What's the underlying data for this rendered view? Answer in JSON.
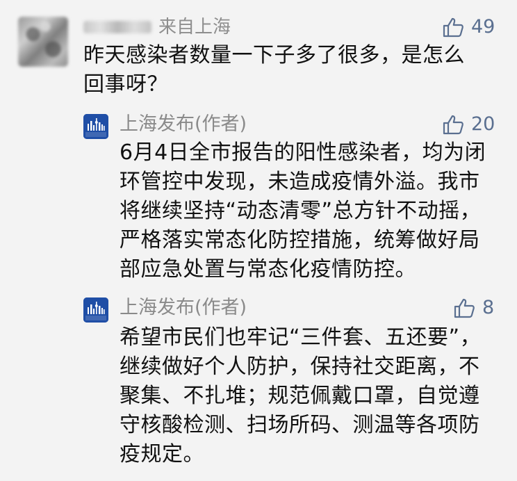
{
  "comment": {
    "location": "来自上海",
    "likes": "49",
    "text_lines": [
      "昨天感染者数量一下子多了很多，是怎么",
      "回事呀？"
    ]
  },
  "replies": [
    {
      "author": "上海发布(作者)",
      "likes": "20",
      "avatar_text": "上海发布",
      "text_lines": [
        "6月4日全市报告的阳性感染者，均为闭",
        "环管控中发现，未造成疫情外溢。我市",
        "将继续坚持“动态清零”总方针不动摇，",
        "严格落实常态化防控措施，统筹做好局",
        "部应急处置与常态化疫情防控。"
      ]
    },
    {
      "author": "上海发布(作者)",
      "likes": "8",
      "avatar_text": "上海发布",
      "text_lines": [
        "希望市民们也牢记“三件套、五还要”，",
        "继续做好个人防护，保持社交距离，不",
        "聚集、不扎堆；规范佩戴口罩，自觉遵",
        "守核酸检测、扫场所码、测温等各项防",
        "疫规定。"
      ]
    }
  ],
  "colors": {
    "background": "#f3f3f3",
    "like": "#5a6f90",
    "meta": "#8a8a8a",
    "official_avatar": "#1f4ea6"
  },
  "icons": {
    "like": "thumbs-up-icon",
    "official_avatar": "shanghai-fabu-logo"
  }
}
